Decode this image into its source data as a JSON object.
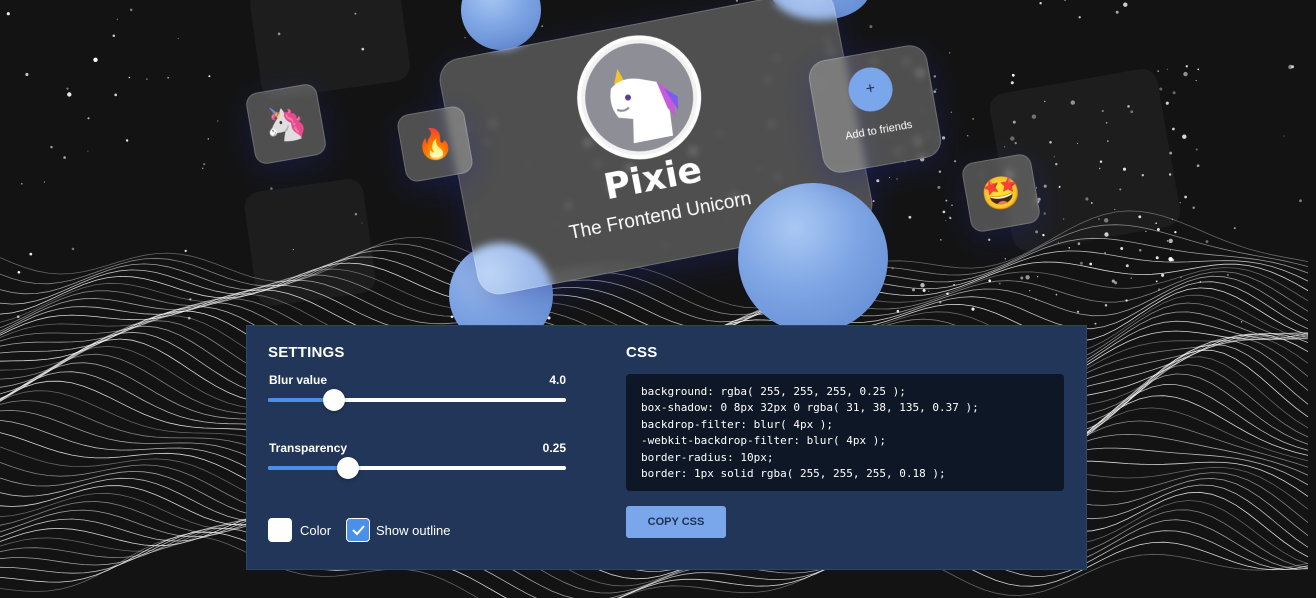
{
  "profile": {
    "name": "Pixie",
    "role": "The Frontend Unicorn",
    "add_friend_icon": "+",
    "add_friend_label": "Add to friends"
  },
  "emojis": {
    "unicorn": "🦄",
    "fire": "🔥",
    "star_struck": "🤩"
  },
  "settings": {
    "title": "SETTINGS",
    "blur": {
      "label": "Blur value",
      "value": "4.0",
      "fraction": 0.22
    },
    "transparency": {
      "label": "Transparency",
      "value": "0.25",
      "fraction": 0.27
    },
    "color_label": "Color",
    "outline_label": "Show outline",
    "outline_checked": true
  },
  "css_panel": {
    "title": "CSS",
    "lines": [
      "background: rgba( 255, 255, 255, 0.25 );",
      "box-shadow: 0 8px 32px 0 rgba( 31, 38, 135, 0.37 );",
      "backdrop-filter: blur( 4px );",
      "-webkit-backdrop-filter: blur( 4px );",
      "border-radius: 10px;",
      "border: 1px solid rgba( 255, 255, 255, 0.18 );"
    ],
    "copy_label": "COPY CSS"
  },
  "colors": {
    "panel": "#213659",
    "accent": "#4a8fe8",
    "button": "#7aa6ec",
    "code_bg": "#0d1726"
  }
}
